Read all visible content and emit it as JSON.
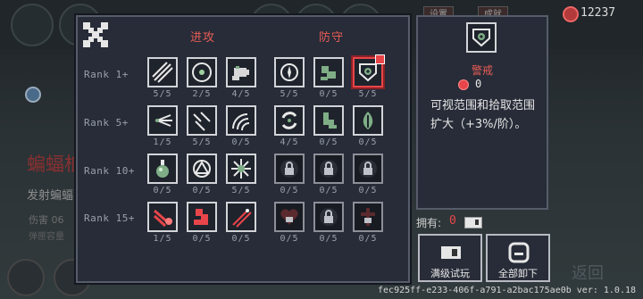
{
  "background": {
    "coin_value": "12237",
    "title": "蝙蝠柢",
    "subtitle": "发射蝙蝠",
    "stat1": "伤害 06",
    "stat2": "弹匣容量",
    "return_label": "返回"
  },
  "tabs": {
    "attack": "进攻",
    "defense": "防守"
  },
  "ranks": [
    "Rank 1+",
    "Rank 5+",
    "Rank 10+",
    "Rank 15+"
  ],
  "skills": {
    "r1": [
      "5/5",
      "2/5",
      "4/5",
      "5/5",
      "0/5",
      "5/5"
    ],
    "r5": [
      "1/5",
      "5/5",
      "0/5",
      "4/5",
      "0/5",
      "0/5"
    ],
    "r10": [
      "0/5",
      "0/5",
      "5/5",
      "0/5",
      "0/5",
      "0/5"
    ],
    "r15": [
      "1/5",
      "0/5",
      "0/5",
      "0/5",
      "0/5",
      "0/5"
    ]
  },
  "detail": {
    "name": "警戒",
    "cost": "0",
    "description": "可视范围和拾取范围扩大（+3%/阶）。"
  },
  "owned": {
    "label": "拥有:",
    "value": "0"
  },
  "buttons": {
    "trial": "满级试玩",
    "unequip": "全部卸下"
  },
  "version": "fec925ff-e233-406f-a791-a2bac175ae0b ver: 1.0.18",
  "colors": {
    "accent": "#e8454a",
    "panel": "#272c38",
    "border": "#565c6a"
  }
}
